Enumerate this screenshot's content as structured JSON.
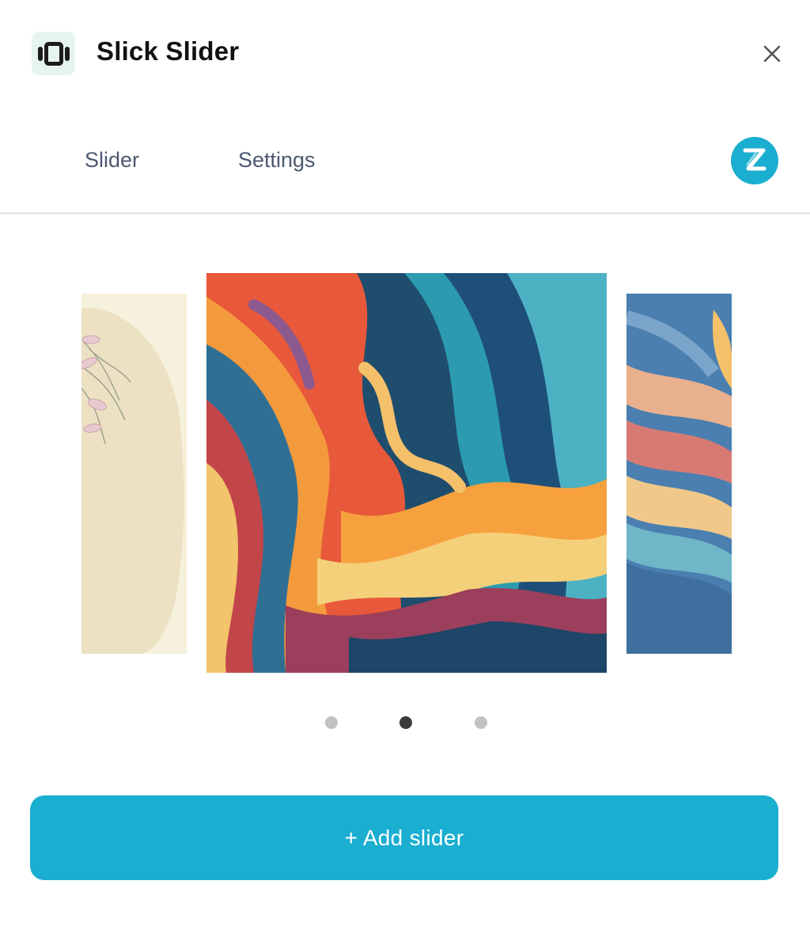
{
  "header": {
    "title": "Slick Slider",
    "app_icon": "carousel-icon",
    "close_icon": "close-icon"
  },
  "tabs": [
    {
      "label": "Slider"
    },
    {
      "label": "Settings"
    }
  ],
  "brand_icon": "z-logo-icon",
  "carousel": {
    "slides": [
      {
        "name": "cream-floral-slide",
        "position": "previous"
      },
      {
        "name": "abstract-waves-slide",
        "position": "current"
      },
      {
        "name": "blue-waves-slide",
        "position": "next"
      }
    ],
    "dots_count": 3,
    "active_index": 1
  },
  "actions": {
    "add_label": "+ Add slider"
  },
  "colors": {
    "accent": "#1aaed0",
    "tab_text": "#4b5870",
    "dot_active": "#3a3a3a",
    "dot_inactive": "#c2c2c2"
  }
}
